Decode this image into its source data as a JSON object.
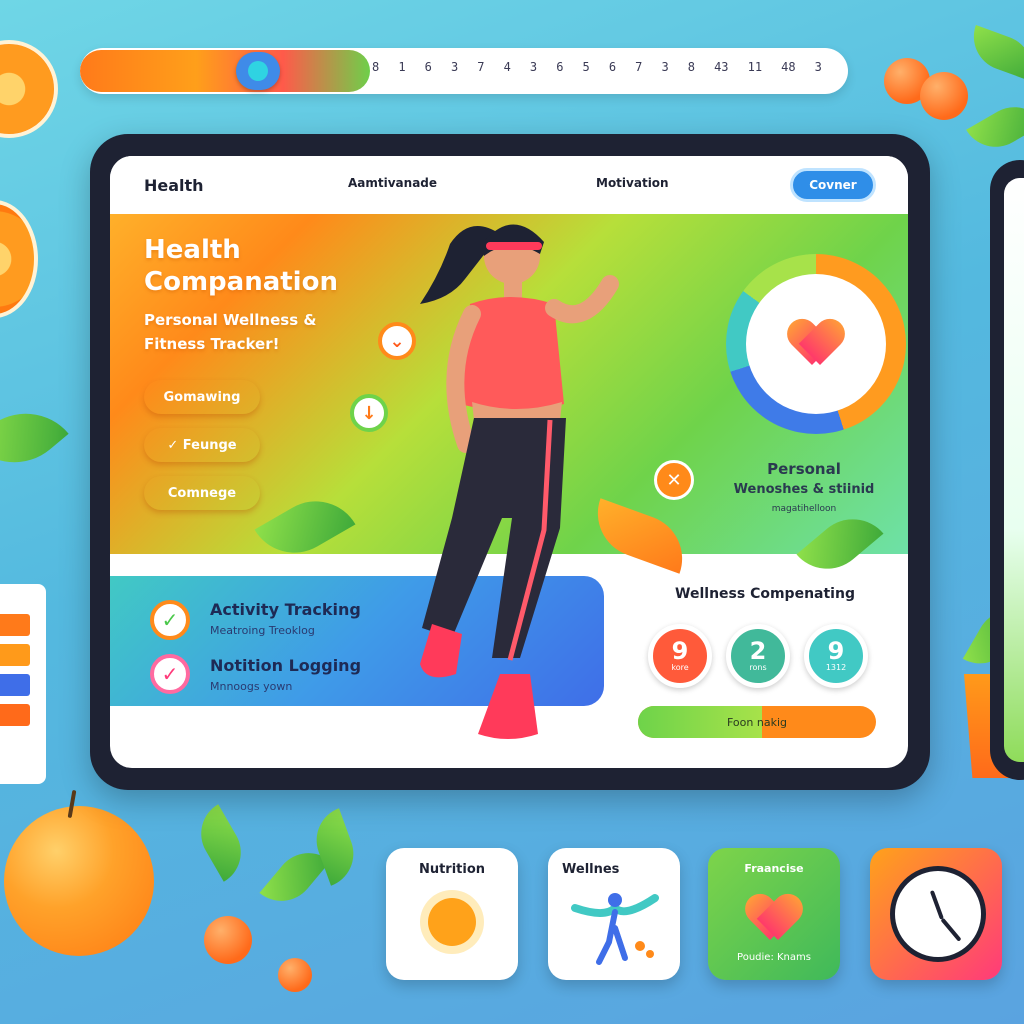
{
  "ruler": {
    "ticks": [
      "8",
      "1",
      "6",
      "3",
      "7",
      "4",
      "3",
      "6",
      "5",
      "6",
      "7",
      "3",
      "8",
      "43",
      "11",
      "48",
      "3"
    ]
  },
  "nav": {
    "brand": "Health",
    "item_1": "Aamtivanade",
    "item_2": "Motivation",
    "cta": "Covner"
  },
  "hero": {
    "title": "Health Companation",
    "subtitle": "Personal Wellness & Fitness Tracker!",
    "pills": [
      {
        "label": "Gomawing",
        "color": "#ff9a1a"
      },
      {
        "label": "✓ Feunge",
        "color": "#ff6a3a"
      },
      {
        "label": "Comnege",
        "color": "#ff7a2a"
      }
    ],
    "side_title": "Personal",
    "side_line": "Wenoshes & stiinid",
    "side_small": "magatihelloon"
  },
  "activity": {
    "rows": [
      {
        "title": "Activity Tracking",
        "sub": "Meatroing Treoklog",
        "check_color": "#4ac84a"
      },
      {
        "title": "Notition Logging",
        "sub": "Mnnoogs yown",
        "check_color": "#ff3a7a"
      }
    ]
  },
  "wellness": {
    "title": "Wellness Compenating",
    "stats": [
      {
        "num": "9",
        "label": "kore",
        "color": "#ff5a3a"
      },
      {
        "num": "2",
        "label": "rons",
        "color": "#41b99a"
      },
      {
        "num": "9",
        "label": "1312",
        "color": "#41c9c4"
      }
    ],
    "progress_label": "Foon nakig",
    "progress": 0.52
  },
  "tiles": [
    {
      "label": "Nutrition"
    },
    {
      "label": "Wellnes"
    },
    {
      "label": "Fraancise",
      "sub": "Poudie: Knams"
    },
    {
      "label": ""
    }
  ],
  "colors": {
    "accent_blue": "#2f8ee8",
    "accent_orange": "#ff8a1a",
    "accent_green": "#6ed34a",
    "frame": "#1e2233"
  },
  "icons": {
    "heart": "heart-icon",
    "sun": "sun-icon",
    "clock": "clock-icon",
    "figure": "wellness-figure-icon"
  }
}
